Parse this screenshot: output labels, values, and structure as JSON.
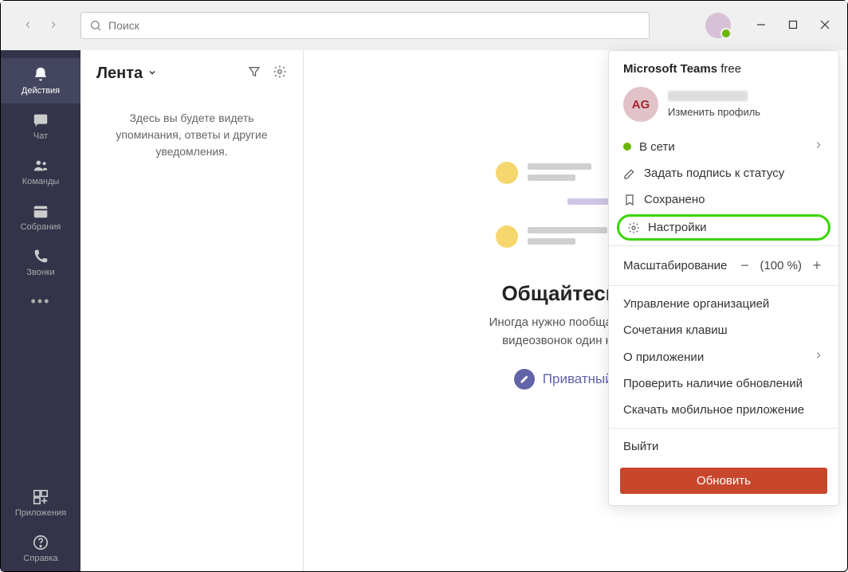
{
  "search": {
    "placeholder": "Поиск"
  },
  "leftbar": {
    "items": [
      {
        "label": "Действия"
      },
      {
        "label": "Чат"
      },
      {
        "label": "Команды"
      },
      {
        "label": "Собрания"
      },
      {
        "label": "Звонки"
      }
    ],
    "more": "•••",
    "apps": "Приложения",
    "help": "Справка"
  },
  "feed": {
    "title": "Лента",
    "empty_text": "Здесь вы будете видеть упоминания, ответы и другие уведомления."
  },
  "main": {
    "title": "Общайтесь пр",
    "subtitle_l1": "Иногда нужно пообщаться в ча",
    "subtitle_l2": "видеозвонок один на один",
    "private_chat": "Приватный чат"
  },
  "dropdown": {
    "brand_bold": "Microsoft Teams",
    "brand_suffix": "free",
    "avatar_initials": "AG",
    "edit_profile": "Изменить профиль",
    "online": "В сети",
    "set_status": "Задать подпись к статусу",
    "saved": "Сохранено",
    "settings": "Настройки",
    "zoom_label": "Масштабирование",
    "zoom_value": "(100 %)",
    "org_management": "Управление организацией",
    "shortcuts": "Сочетания клавиш",
    "about": "О приложении",
    "check_updates": "Проверить наличие обновлений",
    "download_mobile": "Скачать мобильное приложение",
    "sign_out": "Выйти",
    "upgrade": "Обновить"
  }
}
